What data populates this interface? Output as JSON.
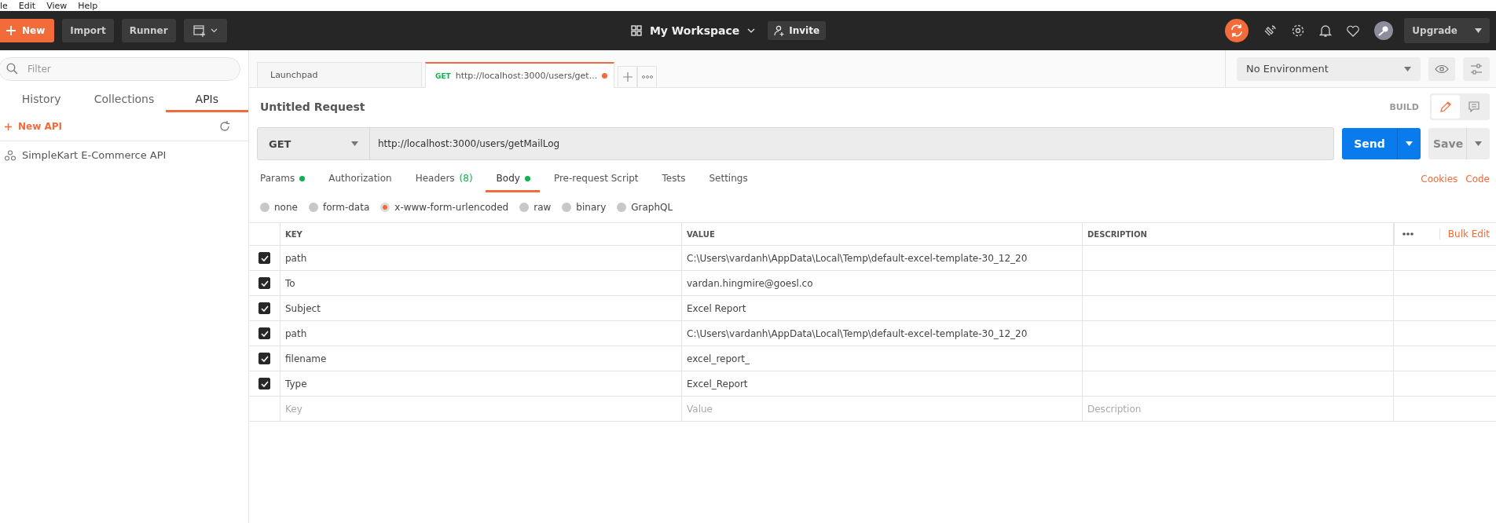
{
  "menu_bar": [
    "le",
    "Edit",
    "View",
    "Help"
  ],
  "toolbar": {
    "new_button": "New",
    "import_button": "Import",
    "runner_button": "Runner",
    "workspace": "My Workspace",
    "invite_button": "Invite",
    "upgrade_button": "Upgrade"
  },
  "sidebar": {
    "filter": {
      "placeholder": "Filter"
    },
    "tabs": [
      {
        "label": "History",
        "selected": false
      },
      {
        "label": "Collections",
        "selected": false
      },
      {
        "label": "APIs",
        "selected": true
      }
    ],
    "new_api": "New API",
    "items": [
      {
        "label": "SimpleKart E-Commerce API"
      }
    ]
  },
  "open_tabs": [
    {
      "label": "Launchpad",
      "selected": false,
      "unsaved": false
    },
    {
      "method": "GET",
      "label": "http://localhost:3000/users/get...",
      "selected": true,
      "unsaved": true
    }
  ],
  "environment": {
    "value": "No Environment"
  },
  "request": {
    "title": "Untitled Request",
    "mode": "BUILD",
    "method": "GET",
    "url": "http://localhost:3000/users/getMailLog",
    "send_button": "Send",
    "save_button": "Save"
  },
  "sections": [
    {
      "label": "Params",
      "dot": true,
      "selected": false
    },
    {
      "label": "Authorization",
      "dot": false,
      "selected": false
    },
    {
      "label": "Headers",
      "count": "(8)",
      "dot": false,
      "selected": false
    },
    {
      "label": "Body",
      "dot": true,
      "selected": true
    },
    {
      "label": "Pre-request Script",
      "dot": false,
      "selected": false
    },
    {
      "label": "Tests",
      "dot": false,
      "selected": false
    },
    {
      "label": "Settings",
      "dot": false,
      "selected": false
    }
  ],
  "links": [
    "Cookies",
    "Code"
  ],
  "body_types": [
    {
      "label": "none",
      "selected": false
    },
    {
      "label": "form-data",
      "selected": false
    },
    {
      "label": "x-www-form-urlencoded",
      "selected": true
    },
    {
      "label": "raw",
      "selected": false
    },
    {
      "label": "binary",
      "selected": false
    },
    {
      "label": "GraphQL",
      "selected": false
    }
  ],
  "table": {
    "columns": [
      "KEY",
      "VALUE",
      "DESCRIPTION"
    ],
    "bulk_edit": "Bulk Edit",
    "rows": [
      {
        "checked": true,
        "key": "path",
        "value": "C:\\Users\\vardanh\\AppData\\Local\\Temp\\default-excel-template-30_12_20"
      },
      {
        "checked": true,
        "key": "To",
        "value": "vardan.hingmire@goesl.co"
      },
      {
        "checked": true,
        "key": "Subject",
        "value": "Excel Report"
      },
      {
        "checked": true,
        "key": "path",
        "value": "C:\\Users\\vardanh\\AppData\\Local\\Temp\\default-excel-template-30_12_20"
      },
      {
        "checked": true,
        "key": "filename",
        "value": "excel_report_"
      },
      {
        "checked": true,
        "key": "Type",
        "value": "Excel_Report"
      }
    ],
    "new_row": {
      "key_placeholder": "Key",
      "value_placeholder": "Value",
      "description_placeholder": "Description"
    }
  }
}
